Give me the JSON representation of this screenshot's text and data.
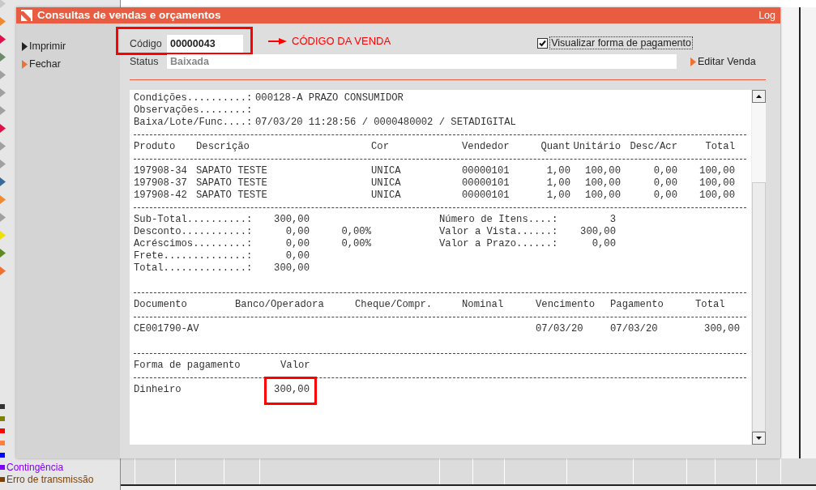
{
  "background": {
    "menu": [
      {
        "color": "#c8c8c8"
      },
      {
        "color": "#f08a30"
      },
      {
        "color": "#e0104a"
      },
      {
        "color": "#6a8a6a"
      },
      {
        "color": "#a0a0a0"
      },
      {
        "color": "#a0a0a0"
      },
      {
        "color": "#a0a0a0"
      },
      {
        "color": "#e0104a"
      },
      {
        "color": "#a0a0a0"
      },
      {
        "color": "#a0a0a0"
      },
      {
        "color": "#3a6a9a"
      },
      {
        "color": "#f08a30"
      },
      {
        "color": "#a0a0a0"
      },
      {
        "color": "#f0e000"
      },
      {
        "color": "#5a8a20"
      },
      {
        "color": "#f07030"
      }
    ],
    "legend": [
      {
        "color": "#333333"
      },
      {
        "color": "#808000"
      },
      {
        "color": "#ff0000"
      },
      {
        "color": "#ff8040"
      },
      {
        "color": "#0000ff"
      },
      {
        "label": "Contingência",
        "color": "#8000ff"
      },
      {
        "label": "Erro de transmissão",
        "color": "#804000"
      }
    ]
  },
  "dialog": {
    "title": "Consultas de vendas e orçamentos",
    "log": "Log",
    "actions": [
      {
        "label": "Imprimir",
        "color": "#222222"
      },
      {
        "label": "Fechar",
        "color": "#f07030"
      }
    ],
    "code_field": {
      "label": "Código",
      "value": "00000043",
      "highlighted": true
    },
    "annotation": {
      "label": "CÓDIGO DA VENDA"
    },
    "status_field": {
      "label": "Status",
      "value": "Baixada"
    },
    "checkbox": {
      "label": "Visualizar forma de pagamento",
      "checked": true
    },
    "edit_link": {
      "label": "Editar Venda"
    },
    "report": {
      "info": [
        {
          "label": "Condições..........:",
          "value": "000128-A PRAZO CONSUMIDOR"
        },
        {
          "label": "Observações........:"
        },
        {
          "label": "Baixa/Lote/Func....:",
          "value": "07/03/20 11:28:56 / 0000480002 / SETADIGITAL"
        }
      ],
      "products": {
        "columns": [
          "Produto",
          "Descrição",
          "Cor",
          "Vendedor",
          "Quant",
          "Unitário",
          "Desc/Acr",
          "Total"
        ],
        "rows": [
          [
            "197908-34",
            "SAPATO TESTE",
            "UNICA",
            "00000101",
            "1,00",
            "100,00",
            "0,00",
            "100,00"
          ],
          [
            "197908-37",
            "SAPATO TESTE",
            "UNICA",
            "00000101",
            "1,00",
            "100,00",
            "0,00",
            "100,00"
          ],
          [
            "197908-42",
            "SAPATO TESTE",
            "UNICA",
            "00000101",
            "1,00",
            "100,00",
            "0,00",
            "100,00"
          ]
        ]
      },
      "totals_left": [
        {
          "label": "Sub-Total..........:",
          "value": "300,00"
        },
        {
          "label": "Desconto...........:",
          "value": "0,00",
          "percent": "0,00%"
        },
        {
          "label": "Acréscimos.........:",
          "value": "0,00",
          "percent": "0,00%"
        },
        {
          "label": "Frete..............:",
          "value": "0,00"
        },
        {
          "label": "Total..............:",
          "value": "300,00"
        }
      ],
      "totals_right": [
        {
          "label": "Número de Itens....:",
          "value": "3"
        },
        {
          "label": "Valor a Vista......:",
          "value": "300,00"
        },
        {
          "label": "Valor a Prazo......:",
          "value": "0,00"
        }
      ],
      "payments": {
        "columns": [
          "Documento",
          "Banco/Operadora",
          "Cheque/Compr.",
          "Nominal",
          "Vencimento",
          "Pagamento",
          "Total"
        ],
        "rows": [
          {
            "document": "CE001790-AV",
            "due": "07/03/20",
            "paid": "07/03/20",
            "total": "300,00"
          }
        ]
      },
      "methods": {
        "columns": [
          "Forma de pagamento",
          "Valor"
        ],
        "rows": [
          {
            "method": "Dinheiro",
            "value": "300,00",
            "highlighted": true
          }
        ]
      }
    }
  }
}
